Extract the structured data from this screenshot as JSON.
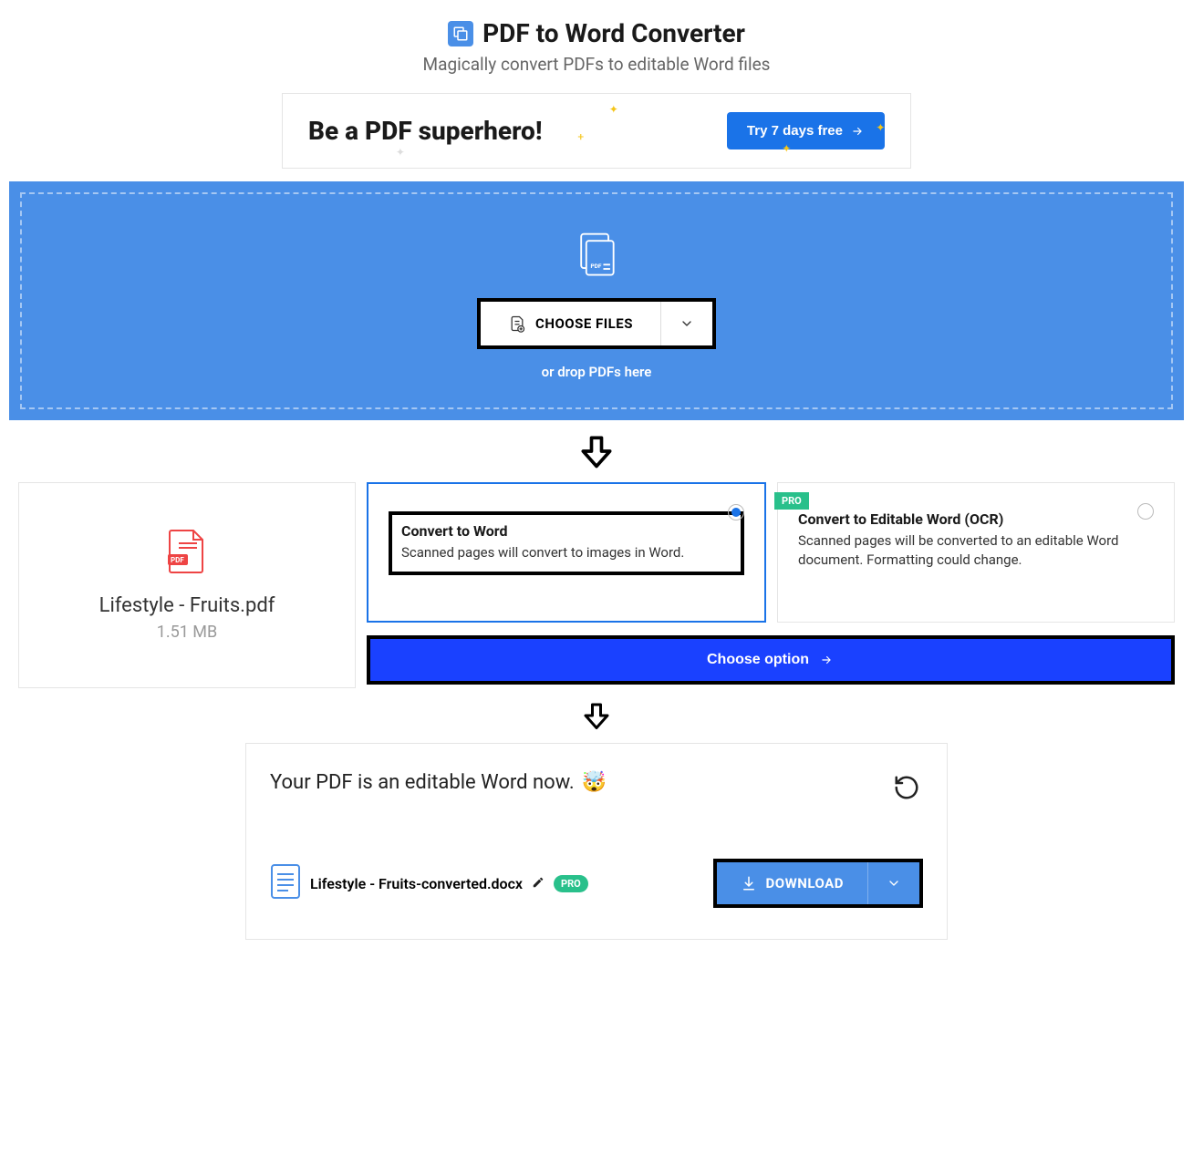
{
  "header": {
    "title": "PDF to Word Converter",
    "subtitle": "Magically convert PDFs to editable Word files"
  },
  "promo": {
    "title": "Be a PDF superhero!",
    "cta": "Try 7 days free"
  },
  "dropzone": {
    "choose_label": "CHOOSE FILES",
    "drop_text": "or drop PDFs here"
  },
  "file": {
    "name": "Lifestyle - Fruits.pdf",
    "size": "1.51 MB"
  },
  "options": {
    "opt1": {
      "title": "Convert to Word",
      "desc": "Scanned pages will convert to images in Word."
    },
    "opt2": {
      "badge": "PRO",
      "title": "Convert to Editable Word (OCR)",
      "desc": "Scanned pages will be converted to an editable Word document. Formatting could change."
    },
    "choose_btn": "Choose option"
  },
  "result": {
    "message": "Your PDF is an editable Word now.",
    "emoji": "🤯",
    "filename": "Lifestyle - Fruits-converted.docx",
    "pro": "PRO",
    "download": "DOWNLOAD"
  }
}
